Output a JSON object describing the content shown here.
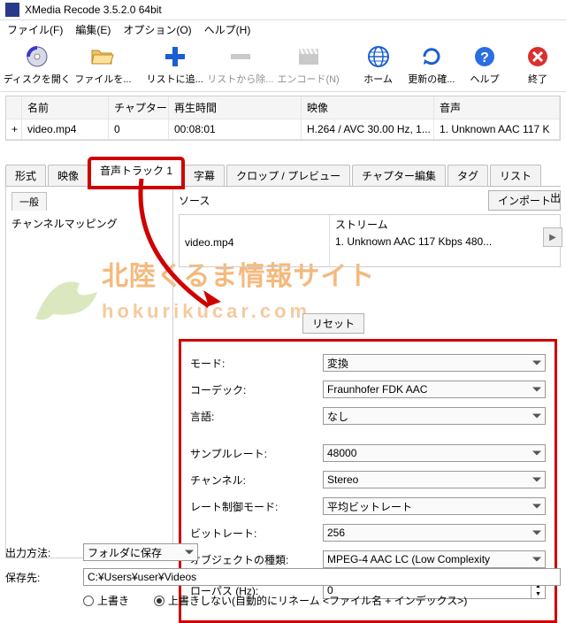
{
  "title": "XMedia Recode 3.5.2.0 64bit",
  "menu": {
    "file": "ファイル(F)",
    "edit": "編集(E)",
    "options": "オプション(O)",
    "help": "ヘルプ(H)"
  },
  "toolbar": {
    "openDisc": "ディスクを開く",
    "openFile": "ファイルを...",
    "addList": "リストに追...",
    "removeList": "リストから除...",
    "encode": "エンコード(N)",
    "home": "ホーム",
    "checkUpdate": "更新の確...",
    "helpBtn": "ヘルプ",
    "exit": "終了"
  },
  "grid": {
    "h_name": "名前",
    "h_chapter": "チャプター",
    "h_duration": "再生時間",
    "h_video": "映像",
    "h_audio": "音声",
    "r_expand": "+",
    "r_name": "video.mp4",
    "r_chapter": "0",
    "r_duration": "00:08:01",
    "r_video": "H.264 / AVC  30.00 Hz,  1...",
    "r_audio": "1. Unknown AAC  117 K"
  },
  "tabs": {
    "format": "形式",
    "video": "映像",
    "audio": "音声トラック 1",
    "subs": "字幕",
    "crop": "クロップ / プレビュー",
    "chap": "チャプター編集",
    "tags": "タグ",
    "list": "リスト"
  },
  "left": {
    "general": "一般",
    "channel": "チャンネルマッピング"
  },
  "src": {
    "label": "ソース",
    "import": "インポート",
    "out": "出",
    "file": "video.mp4",
    "streamH": "ストリーム",
    "stream": "1. Unknown AAC  117 Kbps 480...",
    "next": "▶"
  },
  "reset": "リセット",
  "form": {
    "mode_l": "モード:",
    "mode_v": "変換",
    "codec_l": "コーデック:",
    "codec_v": "Fraunhofer FDK AAC",
    "lang_l": "言語:",
    "lang_v": "なし",
    "sr_l": "サンプルレート:",
    "sr_v": "48000",
    "ch_l": "チャンネル:",
    "ch_v": "Stereo",
    "rc_l": "レート制御モード:",
    "rc_v": "平均ビットレート",
    "br_l": "ビットレート:",
    "br_v": "256",
    "obj_l": "オブジェクトの種類:",
    "obj_v": "MPEG-4 AAC LC (Low Complexity",
    "lp_l": "ローパス (Hz):",
    "lp_v": "0"
  },
  "bottom": {
    "method_l": "出力方法:",
    "method_v": "フォルダに保存",
    "dest_l": "保存先:",
    "dest_v": "C:¥Users¥user¥Videos",
    "overwrite": "上書き",
    "noOverwrite": "上書きしない(自動的にリネーム <ファイル名 + インデックス>)"
  },
  "wm1": "北陸くるま情報サイト",
  "wm2": "hokurikucar.com"
}
